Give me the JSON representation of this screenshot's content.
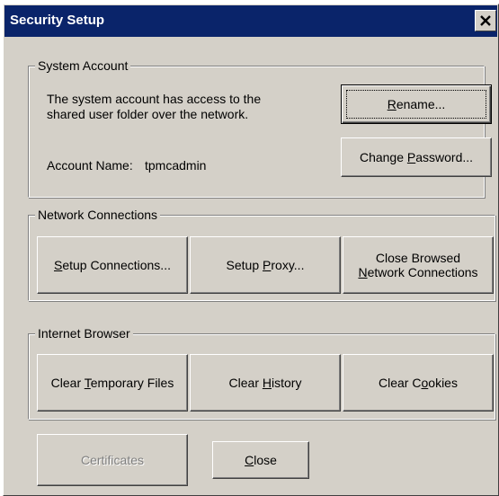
{
  "window": {
    "title": "Security Setup",
    "close_glyph": "✕"
  },
  "system_account": {
    "legend": "System Account",
    "description_line1": "The system account has access to the",
    "description_line2": "shared user folder over the network.",
    "account_name_label": "Account Name:",
    "account_name_value": "tpmcadmin",
    "rename_button": {
      "pre": "",
      "key": "R",
      "post": "ename..."
    },
    "change_password_button": {
      "pre": "Change ",
      "key": "P",
      "post": "assword..."
    }
  },
  "network_connections": {
    "legend": "Network Connections",
    "setup_connections_button": {
      "pre": "",
      "key": "S",
      "post": "etup Connections..."
    },
    "setup_proxy_button": {
      "pre": "Setup ",
      "key": "P",
      "post": "roxy..."
    },
    "close_browsed_button": {
      "line1": "Close Browsed",
      "line2_pre": "",
      "line2_key": "N",
      "line2_post": "etwork Connections"
    }
  },
  "internet_browser": {
    "legend": "Internet Browser",
    "clear_temp_button": {
      "pre": "Clear ",
      "key": "T",
      "post": "emporary Files"
    },
    "clear_history_button": {
      "pre": "Clear ",
      "key": "H",
      "post": "istory"
    },
    "clear_cookies_button": {
      "pre": "Clear C",
      "key": "o",
      "post": "okies"
    }
  },
  "footer": {
    "certificates_button": "Certificates",
    "close_button": {
      "pre": "",
      "key": "C",
      "post": "lose"
    }
  },
  "colors": {
    "titlebar": "#0a246a",
    "face": "#d4d0c8",
    "disabled_text": "#808080"
  }
}
